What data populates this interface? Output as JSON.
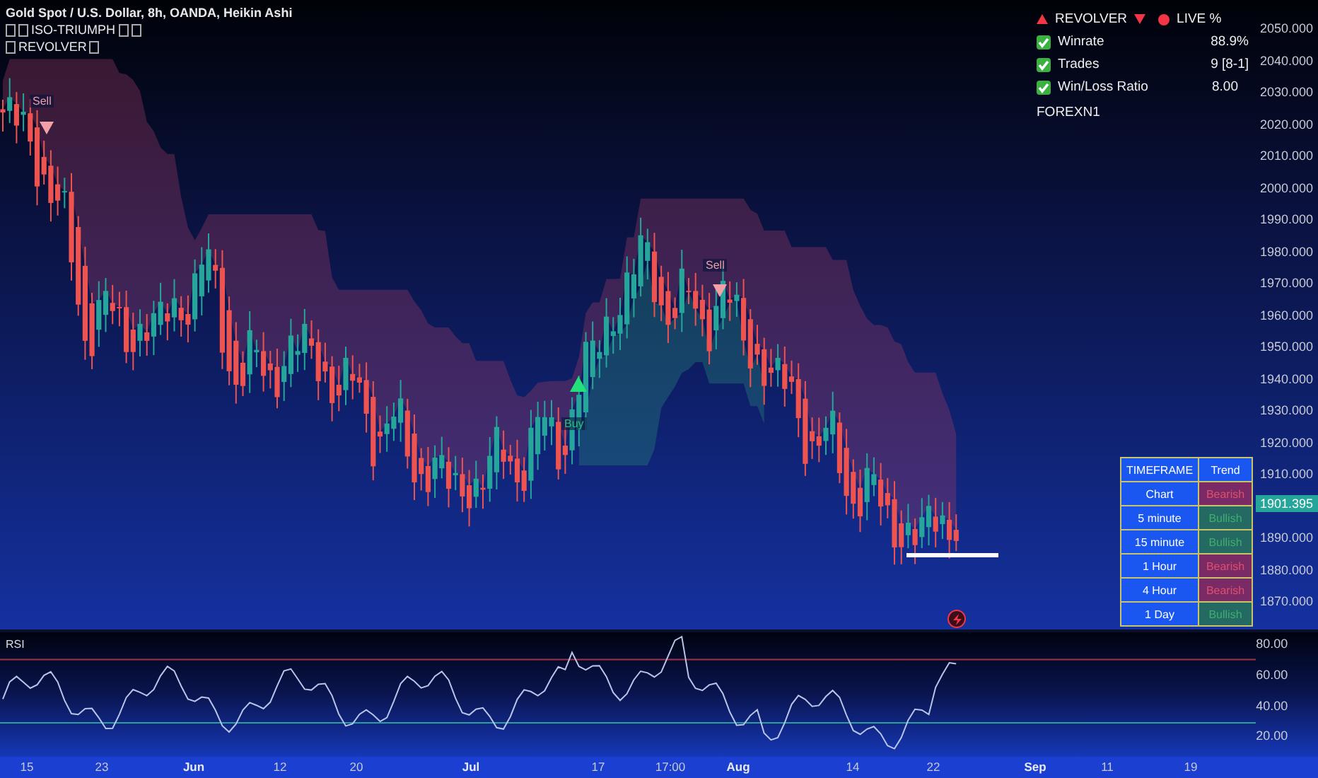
{
  "legend": {
    "title": "Gold Spot / U.S. Dollar, 8h, OANDA, Heikin Ashi",
    "indicators": [
      {
        "name": "ISO-TRIUMPH"
      },
      {
        "name": "REVOLVER"
      }
    ]
  },
  "signals": [
    {
      "kind": "sell",
      "label": "Sell"
    },
    {
      "kind": "sell",
      "label": "Sell"
    },
    {
      "kind": "buy",
      "label": "Buy"
    }
  ],
  "stats": {
    "title": "REVOLVER",
    "live": "LIVE %",
    "rows": [
      {
        "label": "Winrate",
        "value": "88.9%",
        "checked": true
      },
      {
        "label": "Trades",
        "value": "9 [8-1]",
        "checked": true
      },
      {
        "label": "Win/Loss Ratio",
        "value": "8.00",
        "checked": true
      }
    ],
    "footer": "FOREXN1"
  },
  "trend_table": {
    "columns": [
      "TIMEFRAME",
      "Trend"
    ],
    "rows": [
      {
        "timeframe": "Chart",
        "trend": "Bearish",
        "kind": "bearish"
      },
      {
        "timeframe": "5 minute",
        "trend": "Bullish",
        "kind": "bullish"
      },
      {
        "timeframe": "15 minute",
        "trend": "Bullish",
        "kind": "bullish"
      },
      {
        "timeframe": "1 Hour",
        "trend": "Bearish",
        "kind": "bearish"
      },
      {
        "timeframe": "4 Hour",
        "trend": "Bearish",
        "kind": "bearish"
      },
      {
        "timeframe": "1 Day",
        "trend": "Bullish",
        "kind": "bullish"
      }
    ]
  },
  "price_axis": [
    "2050.000",
    "2040.000",
    "2030.000",
    "2020.000",
    "2010.000",
    "2000.000",
    "1990.000",
    "1980.000",
    "1970.000",
    "1960.000",
    "1950.000",
    "1940.000",
    "1930.000",
    "1920.000",
    "1910.000",
    "1890.000",
    "1880.000",
    "1870.000"
  ],
  "last_price": "1901.395",
  "rsi": {
    "label": "RSI",
    "axis": [
      "80.00",
      "60.00",
      "40.00",
      "20.00"
    ]
  },
  "time_axis": [
    {
      "label": "15",
      "kind": "day"
    },
    {
      "label": "23",
      "kind": "day"
    },
    {
      "label": "Jun",
      "kind": "month"
    },
    {
      "label": "12",
      "kind": "day"
    },
    {
      "label": "20",
      "kind": "day"
    },
    {
      "label": "Jul",
      "kind": "month"
    },
    {
      "label": "17",
      "kind": "day"
    },
    {
      "label": "17:00",
      "kind": "day"
    },
    {
      "label": "Aug",
      "kind": "month"
    },
    {
      "label": "14",
      "kind": "day"
    },
    {
      "label": "22",
      "kind": "day"
    },
    {
      "label": "Sep",
      "kind": "month"
    },
    {
      "label": "11",
      "kind": "day"
    },
    {
      "label": "19",
      "kind": "day"
    }
  ]
}
